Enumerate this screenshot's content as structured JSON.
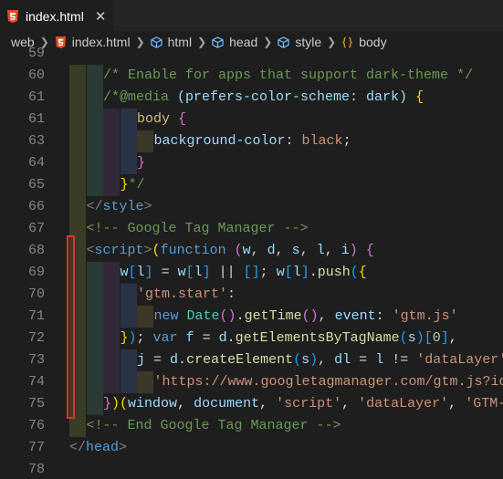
{
  "tab": {
    "title": "index.html",
    "close": "✕"
  },
  "breadcrumb": [
    "web",
    "index.html",
    "html",
    "head",
    "style",
    "body"
  ],
  "lines": [
    {
      "num": "59",
      "tokens": []
    },
    {
      "num": "60",
      "tokens": [
        [
          "c-comment",
          "/* Enable for apps that support dark-theme */"
        ]
      ]
    },
    {
      "num": "61",
      "tokens": [
        [
          "c-comment",
          "/*@media "
        ],
        [
          "c-prop",
          "(prefers-color-scheme: dark)"
        ],
        [
          "c-comment",
          " "
        ],
        [
          "c-brace1",
          "{"
        ]
      ]
    },
    {
      "num": "61",
      "tokens": [
        [
          "c-sel",
          "body"
        ],
        [
          "c-plain",
          " "
        ],
        [
          "c-brace2",
          "{"
        ]
      ]
    },
    {
      "num": "63",
      "tokens": [
        [
          "c-prop",
          "background-color"
        ],
        [
          "c-plain",
          ": "
        ],
        [
          "c-val",
          "black"
        ],
        [
          "c-plain",
          ";"
        ]
      ]
    },
    {
      "num": "64",
      "tokens": [
        [
          "c-brace2",
          "}"
        ]
      ]
    },
    {
      "num": "65",
      "tokens": [
        [
          "c-brace1",
          "}"
        ],
        [
          "c-comment",
          "*/"
        ]
      ]
    },
    {
      "num": "66",
      "tokens": [
        [
          "c-punct",
          "</"
        ],
        [
          "c-tag",
          "style"
        ],
        [
          "c-punct",
          ">"
        ]
      ]
    },
    {
      "num": "67",
      "tokens": [
        [
          "c-comment",
          "<!-- Google Tag Manager -->"
        ]
      ]
    },
    {
      "num": "68",
      "tokens": [
        [
          "c-punct",
          "<"
        ],
        [
          "c-tag",
          "script"
        ],
        [
          "c-punct",
          ">"
        ],
        [
          "c-brace1",
          "("
        ],
        [
          "c-kw",
          "function"
        ],
        [
          "c-plain",
          " "
        ],
        [
          "c-brace2",
          "("
        ],
        [
          "c-var",
          "w"
        ],
        [
          "c-plain",
          ", "
        ],
        [
          "c-var",
          "d"
        ],
        [
          "c-plain",
          ", "
        ],
        [
          "c-var",
          "s"
        ],
        [
          "c-plain",
          ", "
        ],
        [
          "c-var",
          "l"
        ],
        [
          "c-plain",
          ", "
        ],
        [
          "c-var",
          "i"
        ],
        [
          "c-brace2",
          ")"
        ],
        [
          "c-plain",
          " "
        ],
        [
          "c-brace2",
          "{"
        ]
      ]
    },
    {
      "num": "69",
      "tokens": [
        [
          "c-var",
          "w"
        ],
        [
          "c-brace3",
          "["
        ],
        [
          "c-var",
          "l"
        ],
        [
          "c-brace3",
          "]"
        ],
        [
          "c-plain",
          " = "
        ],
        [
          "c-var",
          "w"
        ],
        [
          "c-brace3",
          "["
        ],
        [
          "c-var",
          "l"
        ],
        [
          "c-brace3",
          "]"
        ],
        [
          "c-plain",
          " || "
        ],
        [
          "c-brace3",
          "[]"
        ],
        [
          "c-plain",
          "; "
        ],
        [
          "c-var",
          "w"
        ],
        [
          "c-brace3",
          "["
        ],
        [
          "c-var",
          "l"
        ],
        [
          "c-brace3",
          "]"
        ],
        [
          "c-plain",
          "."
        ],
        [
          "c-fn",
          "push"
        ],
        [
          "c-brace3",
          "("
        ],
        [
          "c-brace1",
          "{"
        ]
      ]
    },
    {
      "num": "70",
      "tokens": [
        [
          "c-str",
          "'gtm.start'"
        ],
        [
          "c-plain",
          ":"
        ]
      ]
    },
    {
      "num": "71",
      "tokens": [
        [
          "c-kw",
          "new"
        ],
        [
          "c-plain",
          " "
        ],
        [
          "c-cls",
          "Date"
        ],
        [
          "c-brace2",
          "()"
        ],
        [
          "c-plain",
          "."
        ],
        [
          "c-fn",
          "getTime"
        ],
        [
          "c-brace2",
          "()"
        ],
        [
          "c-plain",
          ", "
        ],
        [
          "c-var",
          "event"
        ],
        [
          "c-plain",
          ": "
        ],
        [
          "c-str",
          "'gtm.js'"
        ]
      ]
    },
    {
      "num": "72",
      "tokens": [
        [
          "c-brace1",
          "}"
        ],
        [
          "c-brace3",
          ")"
        ],
        [
          "c-plain",
          "; "
        ],
        [
          "c-kw",
          "var"
        ],
        [
          "c-plain",
          " "
        ],
        [
          "c-var",
          "f"
        ],
        [
          "c-plain",
          " = "
        ],
        [
          "c-var",
          "d"
        ],
        [
          "c-plain",
          "."
        ],
        [
          "c-fn",
          "getElementsByTagName"
        ],
        [
          "c-brace3",
          "("
        ],
        [
          "c-var",
          "s"
        ],
        [
          "c-brace3",
          ")"
        ],
        [
          "c-brace3",
          "["
        ],
        [
          "c-num",
          "0"
        ],
        [
          "c-brace3",
          "]"
        ],
        [
          "c-plain",
          ","
        ]
      ]
    },
    {
      "num": "73",
      "tokens": [
        [
          "c-var",
          "j"
        ],
        [
          "c-plain",
          " = "
        ],
        [
          "c-var",
          "d"
        ],
        [
          "c-plain",
          "."
        ],
        [
          "c-fn",
          "createElement"
        ],
        [
          "c-brace3",
          "("
        ],
        [
          "c-var",
          "s"
        ],
        [
          "c-brace3",
          ")"
        ],
        [
          "c-plain",
          ", "
        ],
        [
          "c-var",
          "dl"
        ],
        [
          "c-plain",
          " = "
        ],
        [
          "c-var",
          "l"
        ],
        [
          "c-plain",
          " != "
        ],
        [
          "c-str",
          "'dataLayer'"
        ]
      ]
    },
    {
      "num": "74",
      "tokens": [
        [
          "c-str",
          "'https://www.googletagmanager.com/gtm.js?id='"
        ]
      ]
    },
    {
      "num": "75",
      "tokens": [
        [
          "c-brace2",
          "}"
        ],
        [
          "c-brace1",
          ")"
        ],
        [
          "c-brace1",
          "("
        ],
        [
          "c-var",
          "window"
        ],
        [
          "c-plain",
          ", "
        ],
        [
          "c-var",
          "document"
        ],
        [
          "c-plain",
          ", "
        ],
        [
          "c-str",
          "'script'"
        ],
        [
          "c-plain",
          ", "
        ],
        [
          "c-str",
          "'dataLayer'"
        ],
        [
          "c-plain",
          ", "
        ],
        [
          "c-str",
          "'GTM-XXXX'"
        ],
        [
          "c-brace1",
          ")"
        ],
        [
          "c-plain",
          ";"
        ]
      ]
    },
    {
      "num": "76",
      "tokens": [
        [
          "c-comment",
          "<!-- End Google Tag Manager -->"
        ]
      ]
    },
    {
      "num": "77",
      "tokens": [
        [
          "c-punct",
          "</"
        ],
        [
          "c-tag",
          "head"
        ],
        [
          "c-punct",
          ">"
        ]
      ]
    },
    {
      "num": "78",
      "tokens": []
    }
  ]
}
